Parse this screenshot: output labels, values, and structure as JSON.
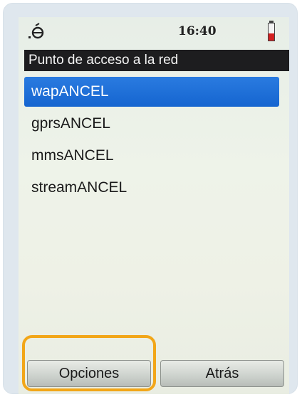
{
  "statusbar": {
    "signal_icon": "signal-antenna-icon",
    "time": "16:40",
    "battery_icon": "battery-low-icon",
    "battery_level": 0.4
  },
  "title": "Punto de acceso a la red",
  "access_points": [
    {
      "label": "wapANCEL",
      "selected": true
    },
    {
      "label": "gprsANCEL",
      "selected": false
    },
    {
      "label": "mmsANCEL",
      "selected": false
    },
    {
      "label": "streamANCEL",
      "selected": false
    }
  ],
  "softkeys": {
    "left_label": "Opciones",
    "right_label": "Atrás"
  },
  "colors": {
    "selection": "#1565d0",
    "titlebar": "#1d1d1f",
    "highlight_outline": "#f2a618",
    "battery": "#d31f1f"
  }
}
